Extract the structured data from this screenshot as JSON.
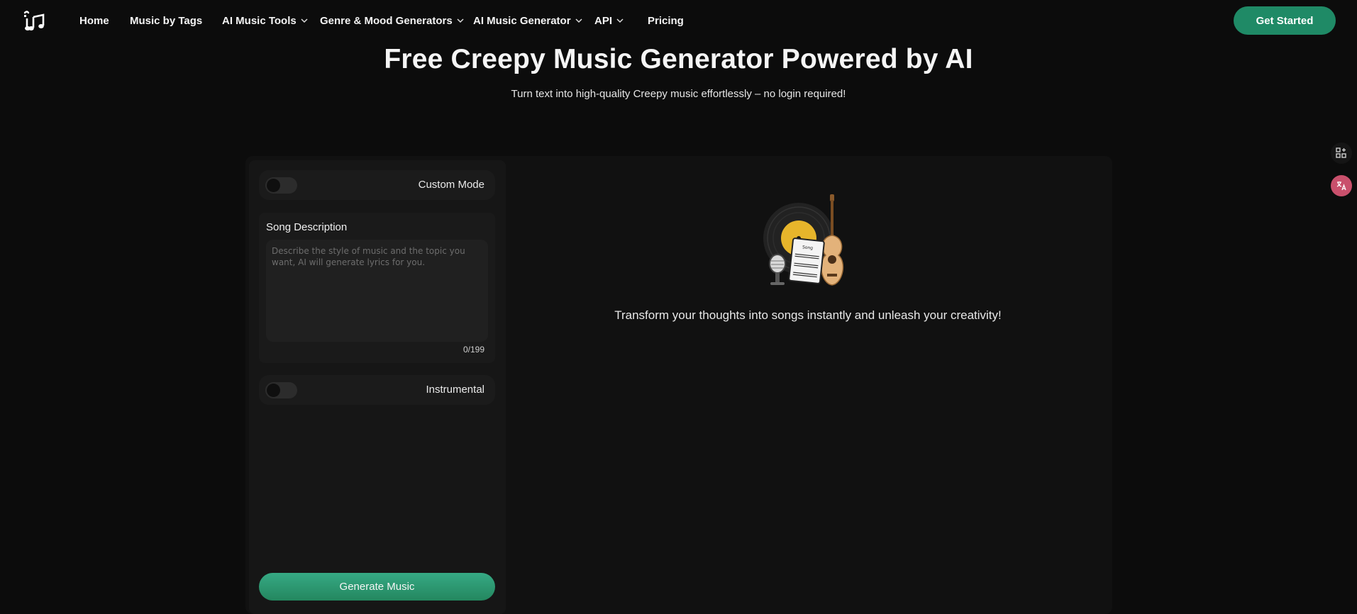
{
  "nav": {
    "logo_icon": "music-note-logo",
    "items": [
      {
        "label": "Home",
        "has_dropdown": false
      },
      {
        "label": "Music by Tags",
        "has_dropdown": false
      },
      {
        "label": "AI Music Tools",
        "has_dropdown": true
      },
      {
        "label": "Genre & Mood Generators",
        "has_dropdown": true
      },
      {
        "label": "AI Music Generator",
        "has_dropdown": true
      },
      {
        "label": "API",
        "has_dropdown": true
      },
      {
        "label": "Pricing",
        "has_dropdown": false
      }
    ],
    "cta_label": "Get Started"
  },
  "hero": {
    "title": "Free Creepy Music Generator Powered by AI",
    "subtitle": "Turn text into high-quality Creepy music effortlessly – no login required!"
  },
  "form": {
    "custom_mode_label": "Custom Mode",
    "custom_mode_on": false,
    "song_description_label": "Song Description",
    "song_description_placeholder": "Describe the style of music and the topic you want, AI will generate lyrics for you.",
    "song_description_value": "",
    "char_counter": "0/199",
    "instrumental_label": "Instrumental",
    "instrumental_on": false,
    "generate_label": "Generate Music"
  },
  "preview": {
    "illustration_icon": "vinyl-guitar-mic-songbook-illustration",
    "tagline": "Transform your thoughts into songs instantly and unleash your creativity!"
  },
  "side_tools": [
    {
      "icon": "apps-add-icon"
    },
    {
      "icon": "translate-icon"
    }
  ],
  "colors": {
    "background": "#0c0c0c",
    "accent_green": "#1f8a66",
    "translate_badge": "#c9506c"
  }
}
